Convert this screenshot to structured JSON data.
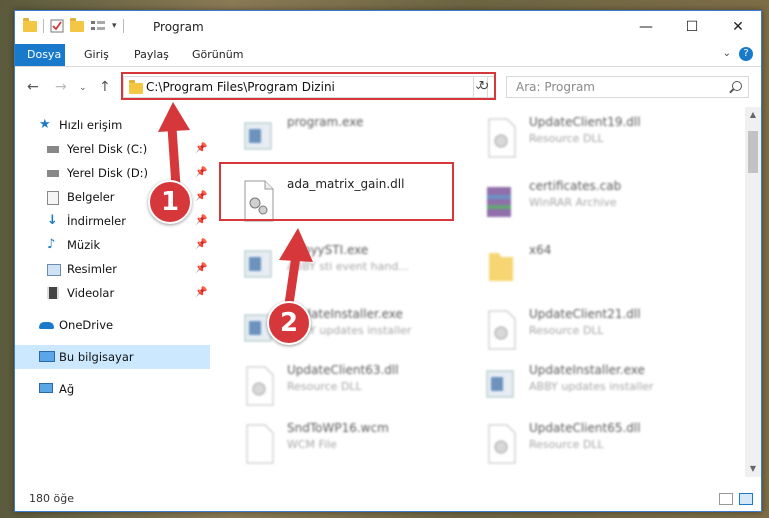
{
  "window": {
    "title": "Program",
    "buttons": {
      "minimize": "—",
      "maximize": "☐",
      "close": "✕"
    }
  },
  "ribbon": {
    "tabs": [
      "Dosya",
      "Giriş",
      "Paylaş",
      "Görünüm"
    ]
  },
  "address": {
    "path": "C:\\Program Files\\Program Dizini",
    "search_placeholder": "Ara: Program"
  },
  "sidebar": {
    "items": [
      {
        "label": "Hızlı erişim",
        "icon": "star-icon"
      },
      {
        "label": "Yerel Disk (C:)",
        "icon": "drive-icon"
      },
      {
        "label": "Yerel Disk (D:)",
        "icon": "drive-icon"
      },
      {
        "label": "Belgeler",
        "icon": "documents-icon"
      },
      {
        "label": "İndirmeler",
        "icon": "download-icon"
      },
      {
        "label": "Müzik",
        "icon": "music-icon"
      },
      {
        "label": "Resimler",
        "icon": "pictures-icon"
      },
      {
        "label": "Videolar",
        "icon": "video-icon"
      },
      {
        "label": "OneDrive",
        "icon": "cloud-icon"
      },
      {
        "label": "Bu bilgisayar",
        "icon": "computer-icon"
      },
      {
        "label": "Ağ",
        "icon": "network-icon"
      }
    ]
  },
  "files": [
    {
      "name": "program.exe",
      "desc": ""
    },
    {
      "name": "UpdateClient19.dll",
      "desc": "Resource DLL"
    },
    {
      "name": "ada_matrix_gain.dll",
      "desc": ""
    },
    {
      "name": "certificates.cab",
      "desc": "WinRAR Archive"
    },
    {
      "name": "AbbyySTI.exe",
      "desc": "ABBY sti event hand..."
    },
    {
      "name": "x64",
      "desc": ""
    },
    {
      "name": "UpdateInstaller.exe",
      "desc": "ABBY updates installer"
    },
    {
      "name": "UpdateClient21.dll",
      "desc": "Resource DLL"
    },
    {
      "name": "UpdateClient63.dll",
      "desc": "Resource DLL"
    },
    {
      "name": "UpdateInstaller.exe",
      "desc": "ABBY updates installer"
    },
    {
      "name": "SndToWP16.wcm",
      "desc": "WCM File"
    },
    {
      "name": "UpdateClient65.dll",
      "desc": "Resource DLL"
    }
  ],
  "status": {
    "count": "180 öğe"
  },
  "annotations": {
    "step1": "1",
    "step2": "2"
  },
  "colors": {
    "accent": "#1979ca",
    "highlight": "#d6373b"
  }
}
